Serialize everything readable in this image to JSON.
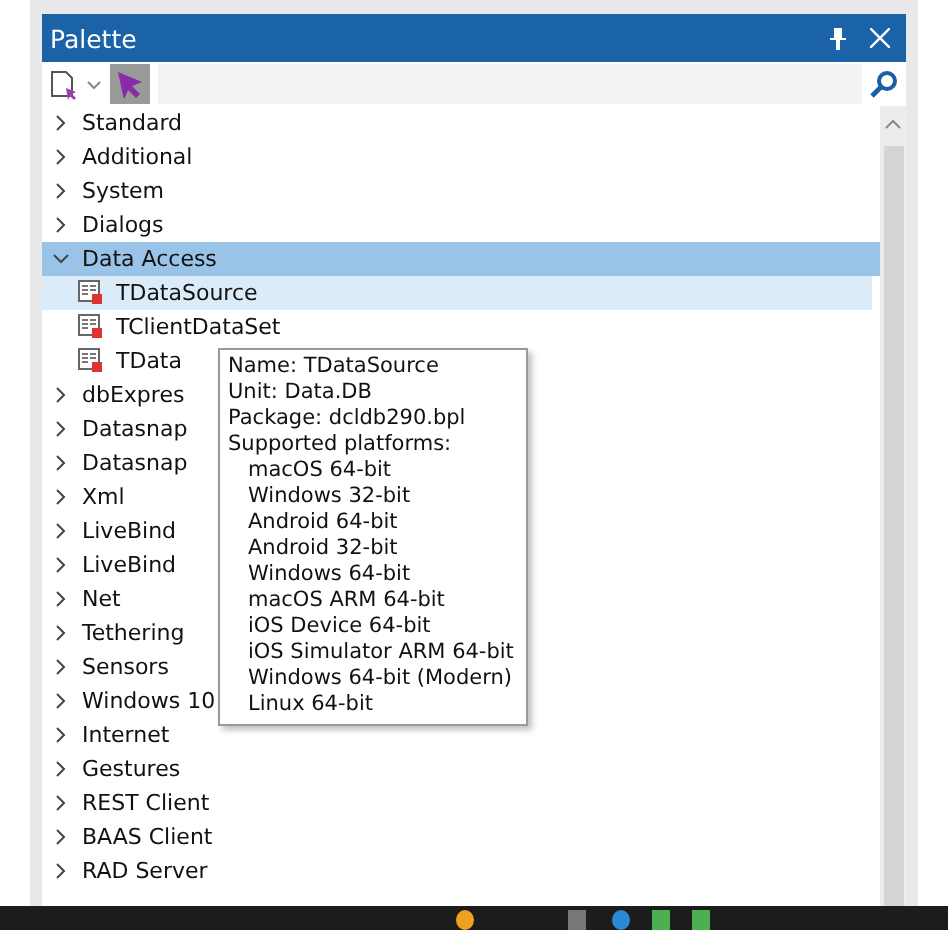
{
  "window": {
    "title": "Palette"
  },
  "categories": [
    {
      "name": "Standard",
      "expanded": false,
      "selected": false
    },
    {
      "name": "Additional",
      "expanded": false,
      "selected": false
    },
    {
      "name": "System",
      "expanded": false,
      "selected": false
    },
    {
      "name": "Dialogs",
      "expanded": false,
      "selected": false
    },
    {
      "name": "Data Access",
      "expanded": true,
      "selected": true,
      "children": [
        {
          "name": "TDataSource",
          "selected": true
        },
        {
          "name": "TClientDataSet",
          "selected": false
        },
        {
          "name": "TData",
          "selected": false
        }
      ]
    },
    {
      "name": "dbExpres",
      "expanded": false,
      "selected": false
    },
    {
      "name": "Datasnap",
      "expanded": false,
      "selected": false
    },
    {
      "name": "Datasnap",
      "expanded": false,
      "selected": false
    },
    {
      "name": "Xml",
      "expanded": false,
      "selected": false
    },
    {
      "name": "LiveBind",
      "expanded": false,
      "selected": false
    },
    {
      "name": "LiveBind",
      "expanded": false,
      "selected": false
    },
    {
      "name": "Net",
      "expanded": false,
      "selected": false
    },
    {
      "name": "Tethering",
      "expanded": false,
      "selected": false
    },
    {
      "name": "Sensors",
      "expanded": false,
      "selected": false
    },
    {
      "name": "Windows 10",
      "expanded": false,
      "selected": false
    },
    {
      "name": "Internet",
      "expanded": false,
      "selected": false
    },
    {
      "name": "Gestures",
      "expanded": false,
      "selected": false
    },
    {
      "name": "REST Client",
      "expanded": false,
      "selected": false
    },
    {
      "name": "BAAS Client",
      "expanded": false,
      "selected": false
    },
    {
      "name": "RAD Server",
      "expanded": false,
      "selected": false
    }
  ],
  "tooltip": {
    "lines": [
      "Name: TDataSource",
      "Unit: Data.DB",
      "Package: dcldb290.bpl",
      "Supported platforms:"
    ],
    "platforms": [
      "macOS 64-bit",
      "Windows 32-bit",
      "Android 64-bit",
      "Android 32-bit",
      "Windows 64-bit",
      "macOS ARM 64-bit",
      "iOS Device 64-bit",
      "iOS Simulator ARM 64-bit",
      "Windows 64-bit (Modern)",
      "Linux 64-bit"
    ]
  }
}
